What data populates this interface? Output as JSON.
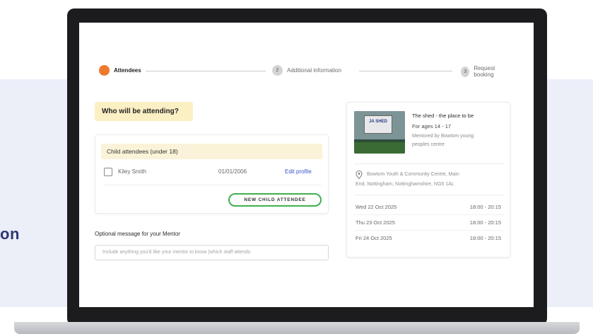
{
  "page": {
    "side_text": "on"
  },
  "stepper": {
    "steps": [
      {
        "label": "Attendees",
        "number": "",
        "state": "active"
      },
      {
        "label": "Additional information",
        "number": "2",
        "state": "inactive"
      },
      {
        "label": "Request booking",
        "number": "3",
        "state": "inactive"
      }
    ],
    "active_color": "#f07a2c"
  },
  "form": {
    "heading": "Who will be attending?",
    "child_section_title": "Child attendees (under 18)",
    "children": [
      {
        "name": "Kiley Smith",
        "dob": "01/01/2006",
        "edit_label": "Edit profile",
        "checked": false
      }
    ],
    "new_child_button": "NEW CHILD ATTENDEE",
    "optional_message_label": "Optional message for your Mentor",
    "optional_message_placeholder": "Include anything you'd like your mentor to know (which staff attends"
  },
  "event": {
    "title": "The shed - the place to be",
    "ages": "For ages 14 - 17",
    "mentored_by_line1": "Mentored by Bowtom young",
    "mentored_by_line2": "peoples centre",
    "image_sign_text": "JA SHED",
    "address_line1": "Bowtom Youth & Community Centre, Main",
    "address_line2": "End, Nottingham, Nottinghamshire, NG5 1AL",
    "sessions": [
      {
        "date": "Wed 22 Oct 2025",
        "time": "18:00 - 20:15"
      },
      {
        "date": "Thu 23 Oct 2025",
        "time": "18:00 - 20:15"
      },
      {
        "date": "Fri 24 Oct 2025",
        "time": "18:00 - 20:15"
      }
    ]
  },
  "colors": {
    "accent_orange": "#f07a2c",
    "heading_highlight": "#fbefc4",
    "button_border_green": "#40b04f",
    "link_blue": "#3a55c9",
    "side_text_blue": "#2a3875"
  }
}
